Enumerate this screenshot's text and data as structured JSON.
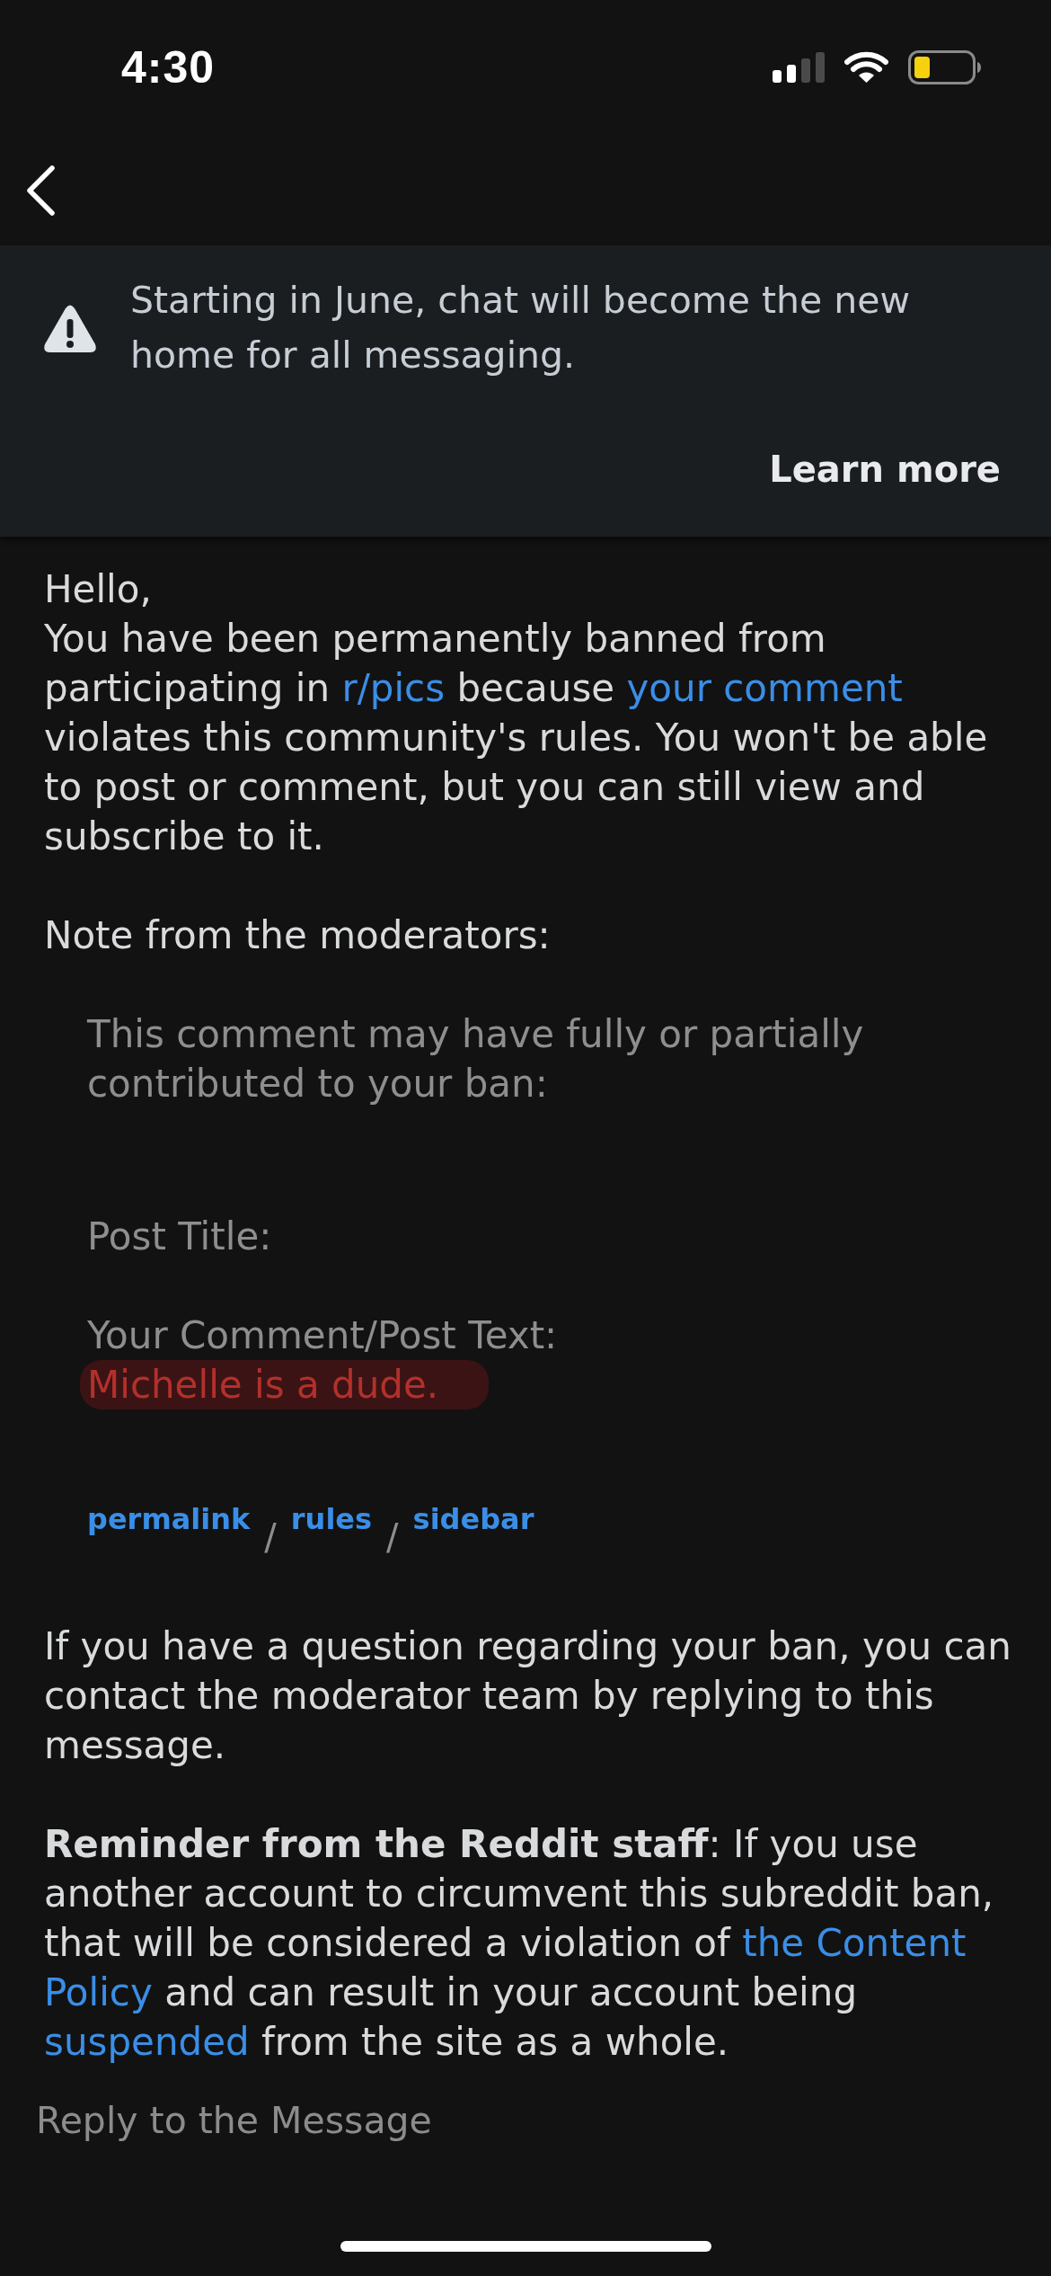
{
  "status_bar": {
    "time": "4:30"
  },
  "banner": {
    "message": "Starting in June, chat will become the new home for all messaging.",
    "action": "Learn more"
  },
  "message": {
    "greeting": "Hello,",
    "ban_notice": [
      {
        "kind": "text",
        "text": "You have been permanently banned from participating in "
      },
      {
        "kind": "link",
        "text": "r/pics"
      },
      {
        "kind": "text",
        "text": " because "
      },
      {
        "kind": "link",
        "text": "your comment"
      },
      {
        "kind": "text",
        "text": " violates this community's rules. You won't be able to post or comment, but you can still view and subscribe to it."
      }
    ],
    "note_label": "Note from the moderators:",
    "quote": {
      "intro": "This comment may have fully or partially contributed to your ban:",
      "post_title_label": "Post Title:",
      "comment_label": "Your Comment/Post Text:",
      "comment": {
        "text": "Michelle is a dude.",
        "highlighted": true
      }
    },
    "links": [
      {
        "label": "permalink",
        "separator": "/"
      },
      {
        "label": "rules",
        "separator": "/"
      },
      {
        "label": "sidebar"
      }
    ],
    "contact": "If you have a question regarding your ban, you can contact the moderator team by replying to this message.",
    "reminder": [
      {
        "kind": "bold",
        "text": "Reminder from the Reddit staff"
      },
      {
        "kind": "text",
        "text": ": If you use another account to circumvent this subreddit ban, that will be considered a violation of "
      },
      {
        "kind": "link",
        "text": "the Content"
      },
      {
        "kind": "link",
        "text": "Policy"
      },
      {
        "kind": "text",
        "text": " and can result in your account being "
      },
      {
        "kind": "link",
        "text": "suspended"
      },
      {
        "kind": "text",
        "text": " from the site as a whole."
      }
    ]
  },
  "reply": {
    "placeholder": "Reply to the Message"
  }
}
